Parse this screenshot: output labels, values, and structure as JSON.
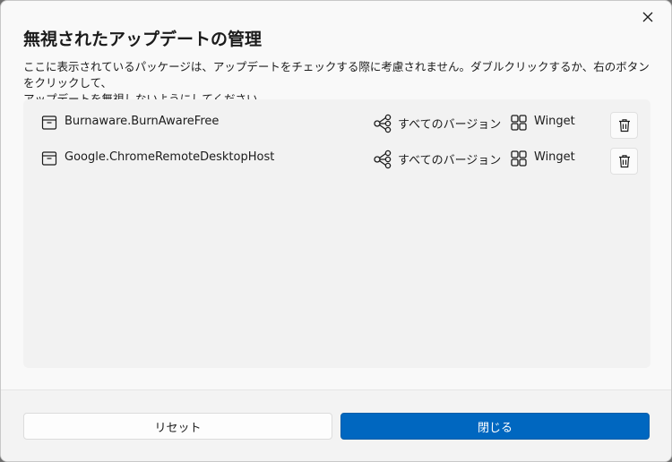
{
  "dialog": {
    "title": "無視されたアップデートの管理",
    "description_line1": "ここに表示されているパッケージは、アップデートをチェックする際に考慮されません。ダブルクリックするか、右のボタンをクリックして、",
    "description_line2": "アップデートを無視しないようにしてください。"
  },
  "packages": [
    {
      "name": "Burnaware.BurnAwareFree",
      "version": "すべてのバージョン",
      "source": "Winget"
    },
    {
      "name": "Google.ChromeRemoteDesktopHost",
      "version": "すべてのバージョン",
      "source": "Winget"
    }
  ],
  "buttons": {
    "reset": "リセット",
    "close": "閉じる"
  },
  "colors": {
    "accent": "#0067c0",
    "list_bg": "#f2f2f2",
    "dialog_bg": "#f9f9f9"
  },
  "icons": {
    "close": "close-icon",
    "package": "package-icon",
    "version": "version-branch-icon",
    "source": "winget-grid-icon",
    "delete": "trash-icon"
  }
}
